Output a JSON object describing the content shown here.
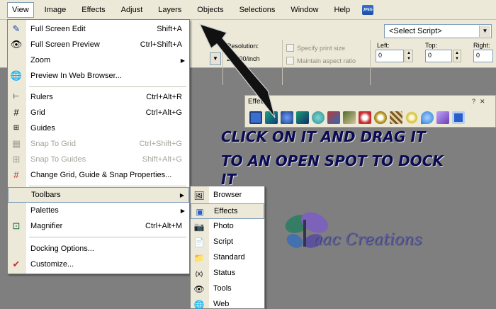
{
  "menubar": {
    "items": [
      "View",
      "Image",
      "Effects",
      "Adjust",
      "Layers",
      "Objects",
      "Selections",
      "Window",
      "Help"
    ],
    "badge": "JPEG"
  },
  "toolbar": {
    "script_select": "<Select Script>",
    "resolution_label": "Resolution:",
    "resolution_value": "200.00/inch",
    "print_size": "Specify print size",
    "aspect_ratio": "Maintain aspect ratio",
    "left_label": "Left:",
    "left_value": "0",
    "top_label": "Top:",
    "top_value": "0",
    "right_label": "Right:",
    "right_value": "0"
  },
  "view_menu": {
    "full_screen_edit": {
      "label": "Full Screen Edit",
      "shortcut": "Shift+A"
    },
    "full_screen_preview": {
      "label": "Full Screen Preview",
      "shortcut": "Ctrl+Shift+A"
    },
    "zoom": {
      "label": "Zoom"
    },
    "preview_web": {
      "label": "Preview In Web Browser..."
    },
    "rulers": {
      "label": "Rulers",
      "shortcut": "Ctrl+Alt+R"
    },
    "grid": {
      "label": "Grid",
      "shortcut": "Ctrl+Alt+G"
    },
    "guides": {
      "label": "Guides"
    },
    "snap_grid": {
      "label": "Snap To Grid",
      "shortcut": "Ctrl+Shift+G"
    },
    "snap_guides": {
      "label": "Snap To Guides",
      "shortcut": "Shift+Alt+G"
    },
    "change_grid": {
      "label": "Change Grid, Guide & Snap Properties..."
    },
    "toolbars": {
      "label": "Toolbars"
    },
    "palettes": {
      "label": "Palettes"
    },
    "magnifier": {
      "label": "Magnifier",
      "shortcut": "Ctrl+Alt+M"
    },
    "docking": {
      "label": "Docking Options..."
    },
    "customize": {
      "label": "Customize..."
    }
  },
  "toolbars_submenu": [
    "Browser",
    "Effects",
    "Photo",
    "Script",
    "Standard",
    "Status",
    "Tools",
    "Web"
  ],
  "effects_toolbar": {
    "title": "Effects",
    "icon_colors": [
      "#3a6fd0",
      "#1ea37a",
      "#2f62c4",
      "#1a9c74",
      "#2d8f8f",
      "#b83a3a",
      "#4f6c2c",
      "#c72e2e",
      "#c3a42f",
      "#7b5a2b",
      "#d6c12d",
      "#2a7dd4",
      "#6a3fae",
      "#2a5fc9"
    ]
  },
  "annotation": {
    "line1": "CLICK ON IT AND DRAG IT",
    "line2": "TO AN OPEN SPOT TO DOCK",
    "line3": "IT"
  },
  "watermark": {
    "text": "aac Creations"
  }
}
